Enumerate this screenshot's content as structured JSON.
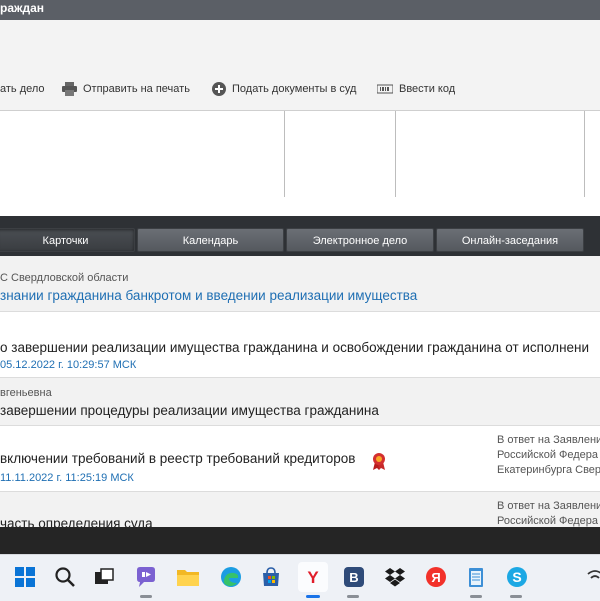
{
  "window": {
    "title": "раждан"
  },
  "toolbar": {
    "items": [
      {
        "label": "ать дело",
        "icon": "add-case-icon"
      },
      {
        "label": "Отправить на печать",
        "icon": "printer-icon"
      },
      {
        "label": "Подать документы в суд",
        "icon": "plus-circle-icon"
      },
      {
        "label": "Ввести код",
        "icon": "barcode-icon"
      }
    ]
  },
  "tabs": [
    {
      "label": "Карточки",
      "active": true
    },
    {
      "label": "Календарь",
      "active": false
    },
    {
      "label": "Электронное дело",
      "active": false
    },
    {
      "label": "Онлайн-заседания",
      "active": false
    }
  ],
  "case": {
    "court": "С Свердловской области",
    "title": "знании гражданина банкротом и введении реализации имущества"
  },
  "entries": [
    {
      "title": "о завершении реализации имущества гражданина и освобождении гражданина от исполнени",
      "date": "05.12.2022 г. 10:29:57 МСК"
    },
    {
      "author": "вгеньевна",
      "title": "завершении процедуры реализации имущества гражданина"
    },
    {
      "title": "включении требований в реестр требований кредиторов",
      "date": "11.11.2022 г. 11:25:19 МСК",
      "side": [
        "В ответ на Заявлени",
        "Российской Федера",
        "Екатеринбурга Свер"
      ],
      "badge_icon": "ribbon-award-icon"
    },
    {
      "title": "часть определения суда",
      "side": [
        "В ответ на Заявлени",
        "Российской Федера"
      ]
    }
  ],
  "taskbar": {
    "icons": [
      "windows-start-icon",
      "search-icon",
      "task-view-icon",
      "chat-icon",
      "file-explorer-icon",
      "edge-browser-icon",
      "store-icon",
      "yandex-browser-icon",
      "vk-icon",
      "dropbox-icon",
      "yandex-icon",
      "notepad-icon",
      "skype-icon",
      "overflow-icon"
    ]
  },
  "colors": {
    "accent_link": "#1f6fb3",
    "tabbar": "#2e3135",
    "badge": "#c62828"
  }
}
